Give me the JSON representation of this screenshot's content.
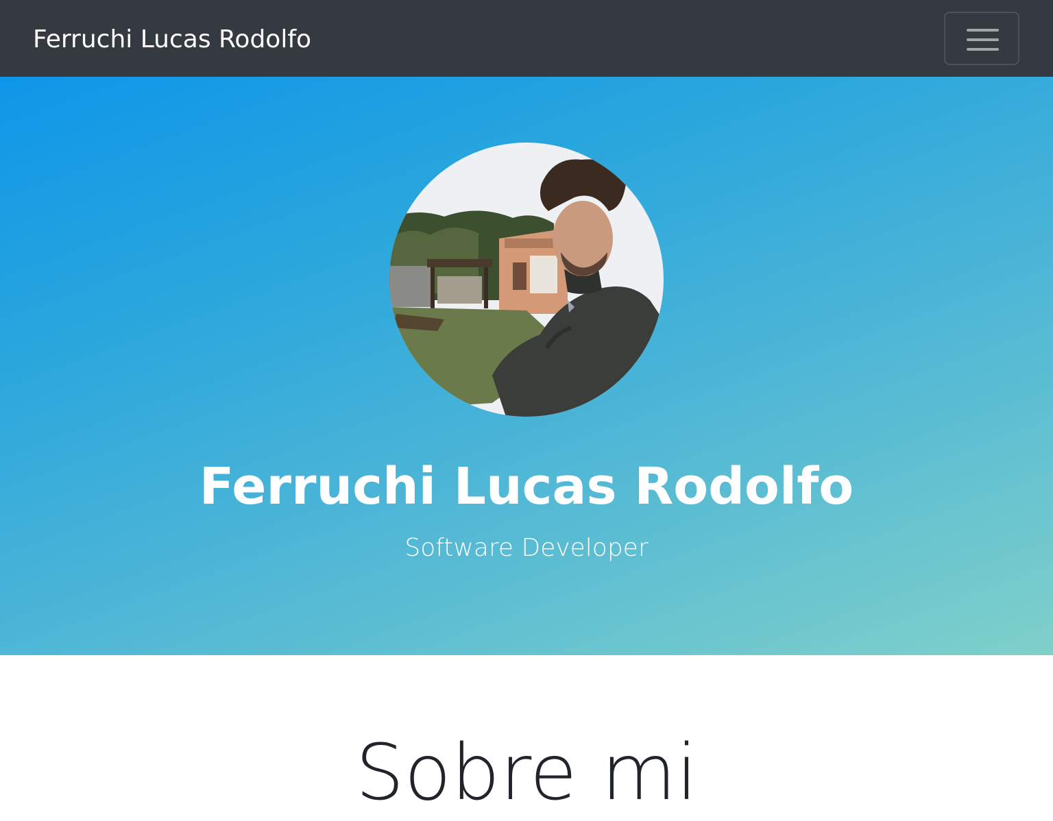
{
  "navbar": {
    "brand": "Ferruchi Lucas Rodolfo",
    "toggler_icon": "hamburger-menu-icon"
  },
  "hero": {
    "avatar": "profile-photo",
    "name": "Ferruchi Lucas Rodolfo",
    "role": "Software Developer"
  },
  "about": {
    "title": "Sobre mi"
  },
  "colors": {
    "navbar_bg": "#343a40",
    "hero_gradient_start": "#0e96e8",
    "hero_gradient_end": "#7fd0c9",
    "title_text": "#212529"
  }
}
